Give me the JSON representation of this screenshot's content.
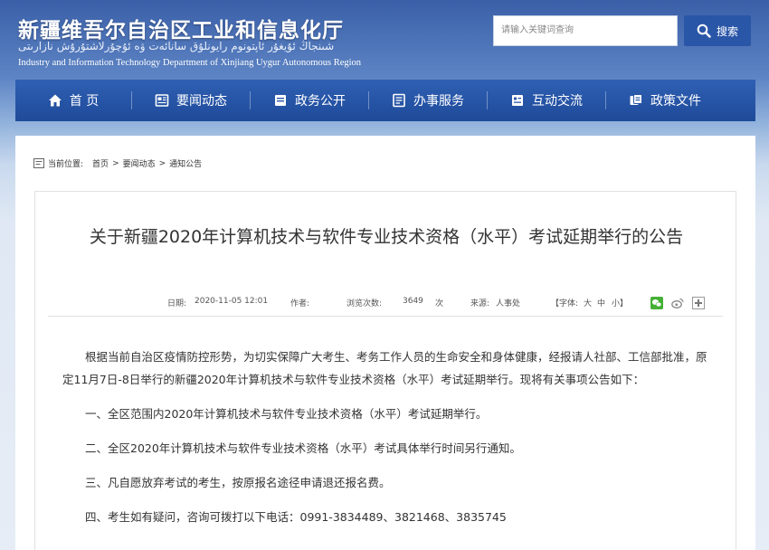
{
  "header": {
    "title": "新疆维吾尔自治区工业和信息化厅",
    "title_uyghur": "شىنجاڭ ئۇيغۇر ئاپتونوم رايونلۇق سانائەت ۋە ئۇچۇرلاشتۇرۇش نازارىتى",
    "title_en": "Industry and Information Technology Department of Xinjiang Uygur Autonomous Region"
  },
  "search": {
    "placeholder": "请输入关键词查询",
    "button_label": "搜索"
  },
  "nav": {
    "items": [
      {
        "label": "首 页",
        "icon": "home-icon"
      },
      {
        "label": "要闻动态",
        "icon": "news-icon"
      },
      {
        "label": "政务公开",
        "icon": "folder-icon"
      },
      {
        "label": "办事服务",
        "icon": "service-icon"
      },
      {
        "label": "互动交流",
        "icon": "interaction-icon"
      },
      {
        "label": "政策文件",
        "icon": "document-icon"
      }
    ]
  },
  "breadcrumb": {
    "prefix": "当前位置:",
    "items": [
      "首页",
      "要闻动态",
      "通知公告"
    ],
    "separator": ">"
  },
  "article": {
    "title": "关于新疆2020年计算机技术与软件专业技术资格（水平）考试延期举行的公告",
    "meta": {
      "date_label": "日期:",
      "date_value": "2020-11-05 12:01",
      "author_label": "作者:",
      "views_label": "浏览次数:",
      "views_value": "3649",
      "views_unit": "次",
      "source_label": "来源:",
      "source_value": "人事处",
      "font_label": "【字体:",
      "font_large": "大",
      "font_medium": "中",
      "font_small": "小】"
    },
    "paragraphs": [
      "根据当前自治区疫情防控形势，为切实保障广大考生、考务工作人员的生命安全和身体健康，经报请人社部、工信部批准，原定11月7日-8日举行的新疆2020年计算机技术与软件专业技术资格（水平）考试延期举行。现将有关事项公告如下：",
      "一、全区范围内2020年计算机技术与软件专业技术资格（水平）考试延期举行。",
      "二、全区2020年计算机技术与软件专业技术资格（水平）考试具体举行时间另行通知。",
      "三、凡自愿放弃考试的考生，按原报名途径申请退还报名费。",
      "四、考生如有疑问，咨询可拨打以下电话：0991-3834489、3821468、3835745"
    ]
  },
  "colors": {
    "nav_bg": "#2a56a8",
    "text": "#333333",
    "wechat": "#45b035",
    "weibo": "#888888"
  }
}
